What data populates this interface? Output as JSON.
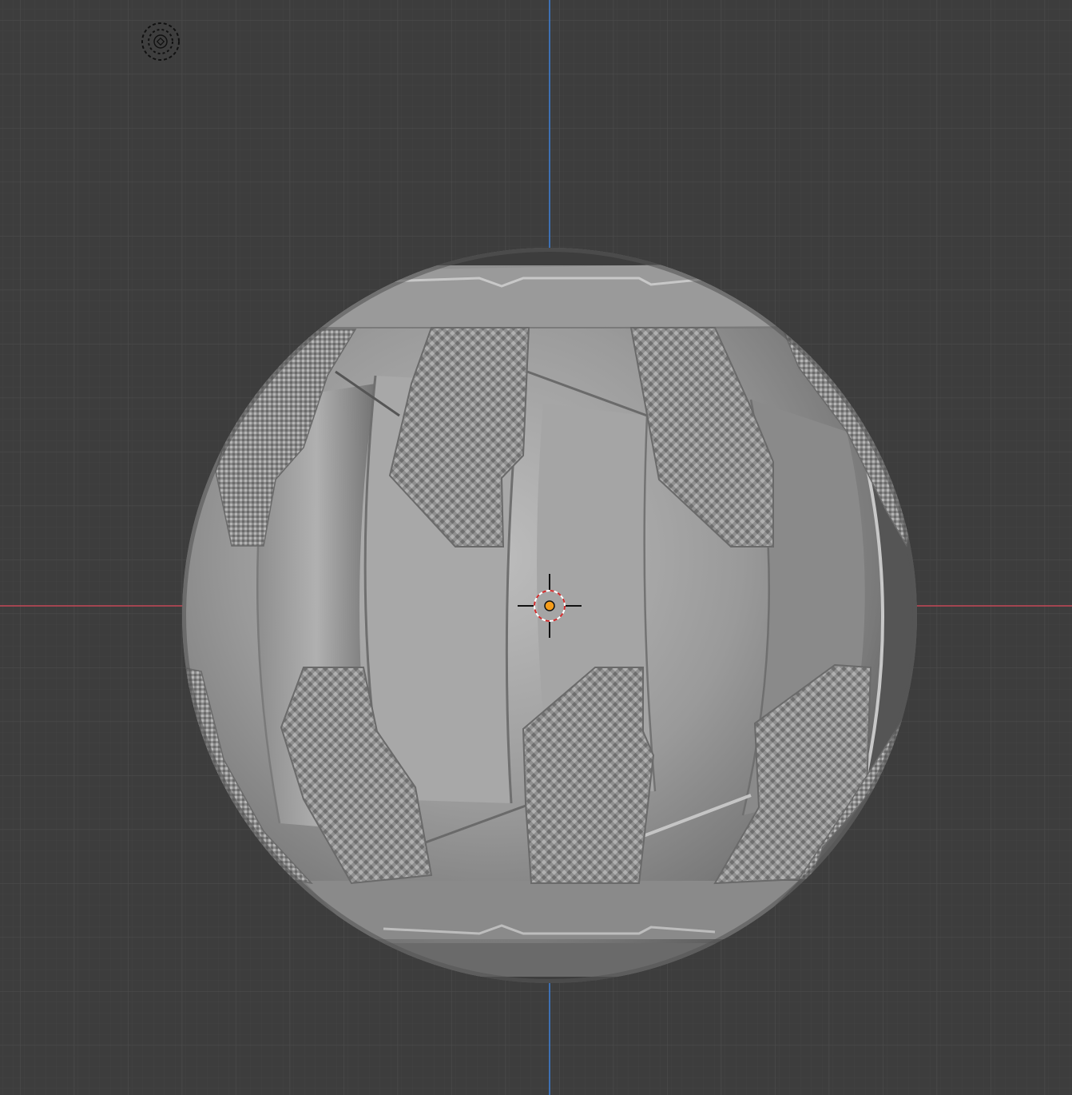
{
  "viewport": {
    "kind": "3d-viewport",
    "view": "front-orthographic",
    "mode": "solid-shading",
    "background_color": "#3d3d3d",
    "grid_minor_color": "#444444",
    "grid_major_color": "#4a4a4a",
    "x_axis_color": "#c34856",
    "z_axis_color": "#3f7ed1"
  },
  "light_gizmo": {
    "icon": "sun-lamp-icon"
  },
  "object": {
    "description": "sci-fi-panel-sphere",
    "base_color": "#8c8c8c",
    "highlight_color": "#b8b8b8",
    "shadow_color": "#505050",
    "knurl_color": "#959595"
  },
  "cursor": {
    "icon": "3d-cursor-icon",
    "ring_color": "#d12b2b"
  },
  "origin": {
    "icon": "object-origin-icon",
    "color": "#f59d1c"
  }
}
